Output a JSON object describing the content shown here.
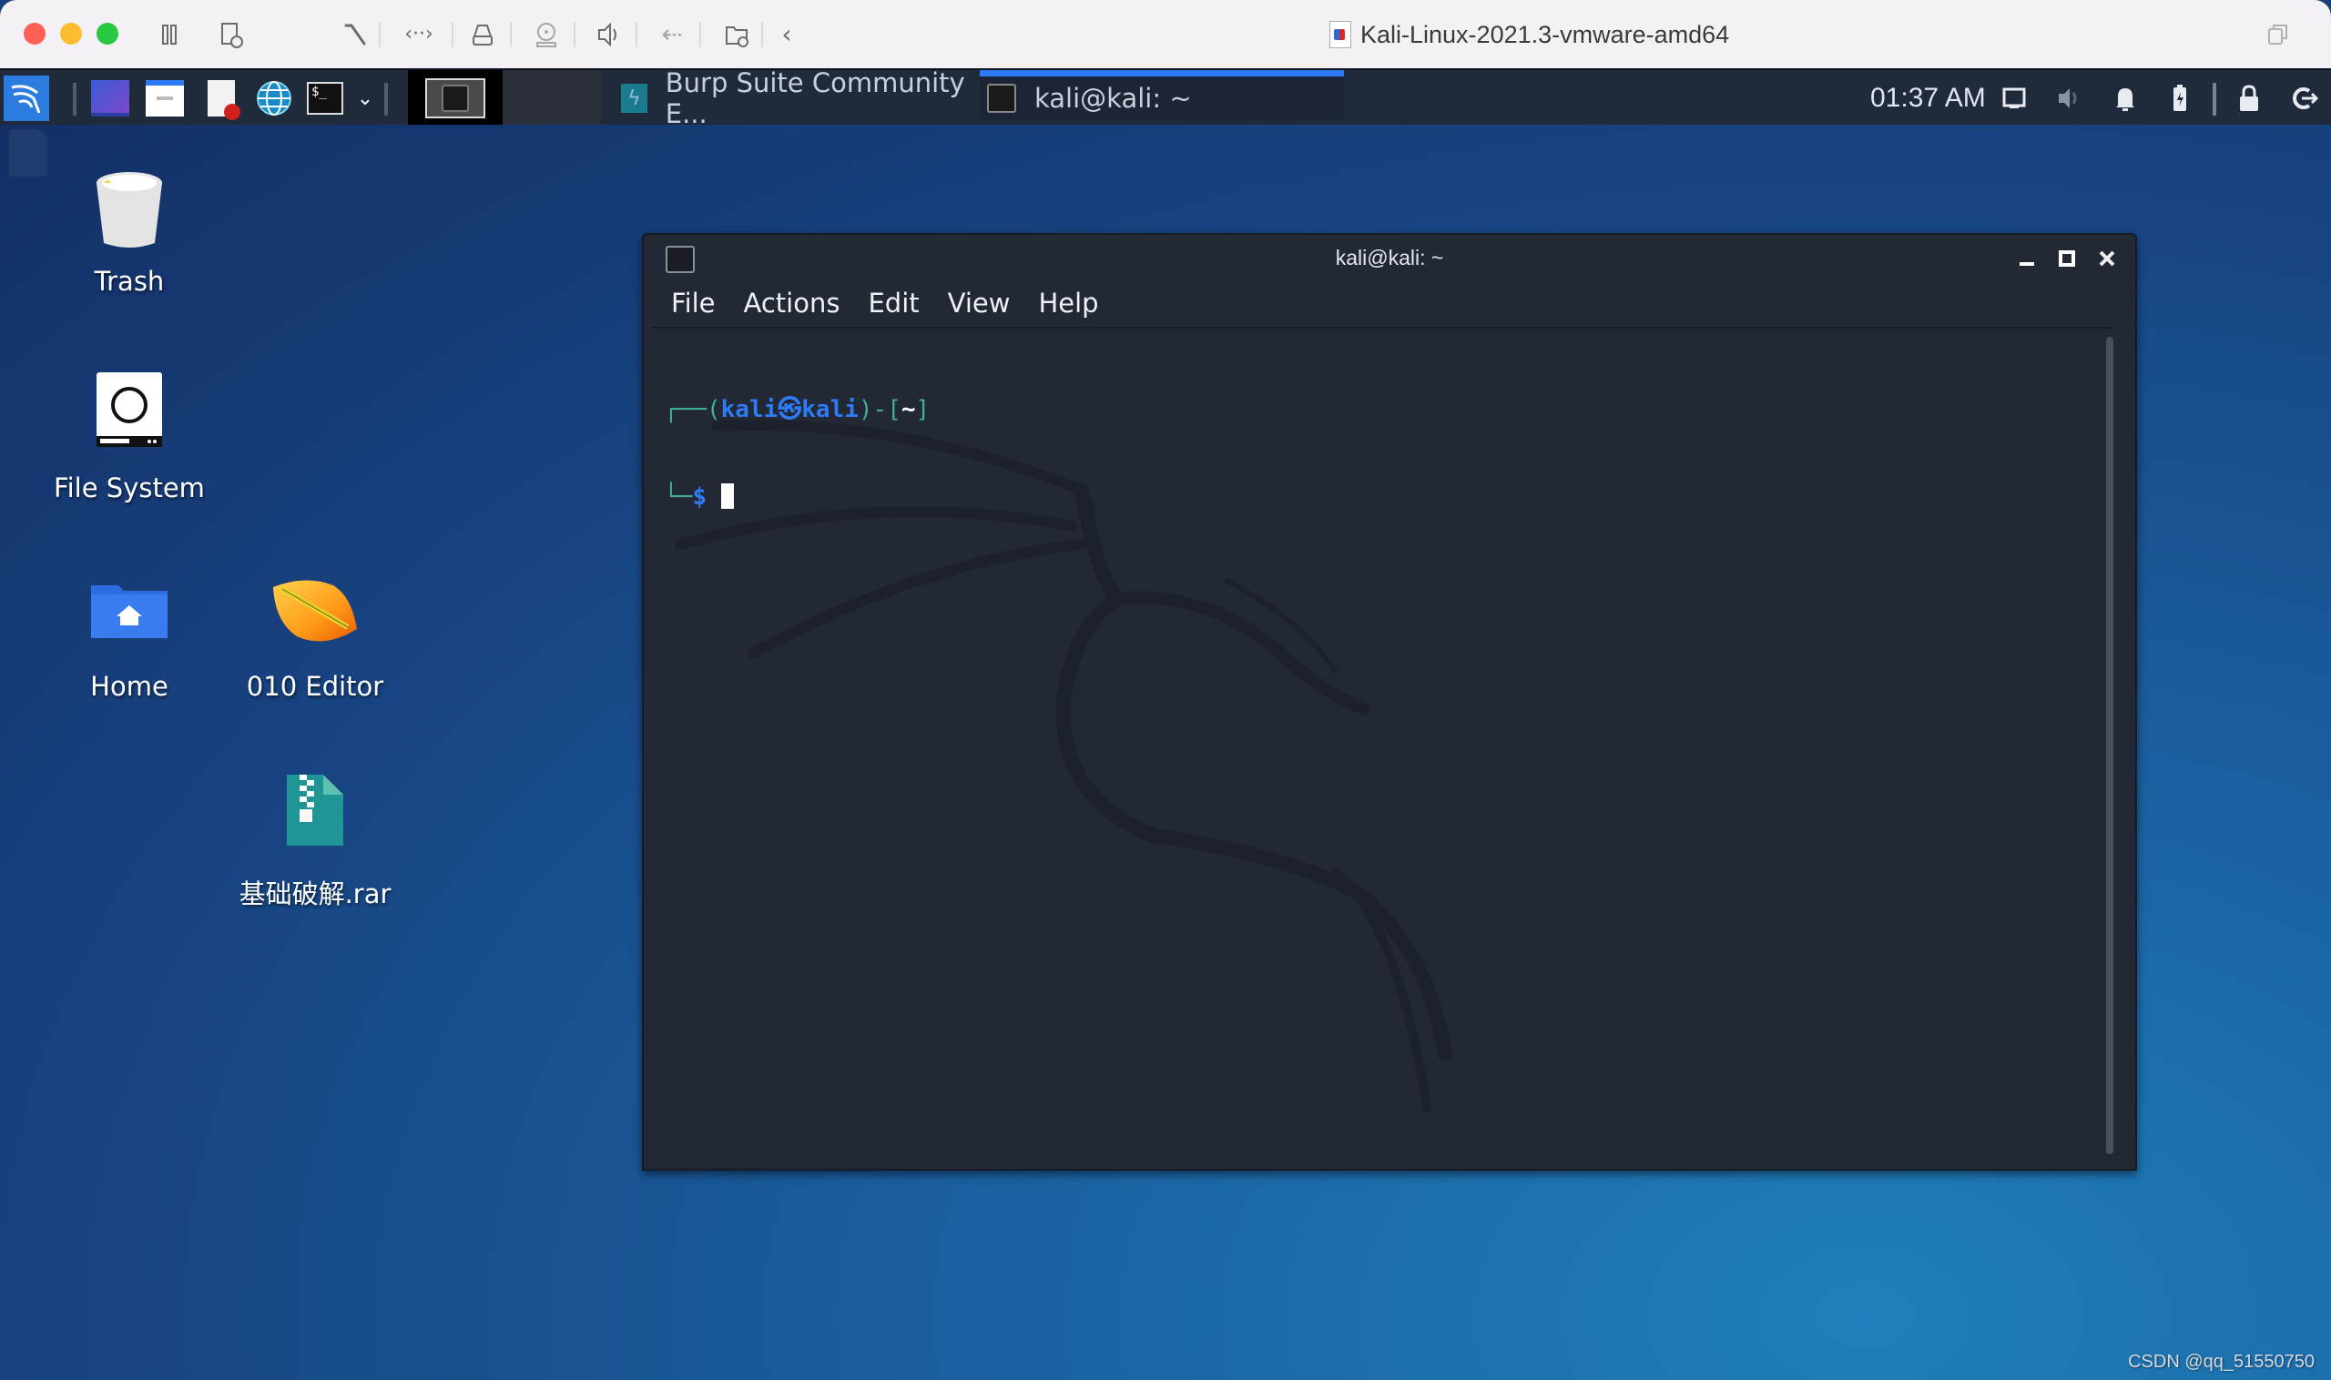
{
  "vm_window": {
    "title": "Kali-Linux-2021.3-vmware-amd64",
    "toolbar_icons": [
      "pause-icon",
      "snapshot-icon",
      "settings-wrench-icon",
      "network-icon",
      "disk-icon",
      "cd-dvd-icon",
      "sound-icon",
      "usb-icon",
      "shared-folder-icon",
      "back-chevron-icon"
    ]
  },
  "panel": {
    "launchers": [
      "kali-menu-icon",
      "show-desktop-icon",
      "file-manager-icon",
      "text-editor-icon",
      "web-browser-icon",
      "terminal-icon"
    ],
    "tasks": [
      {
        "label": "Burp Suite Community E...",
        "icon": "burp-suite-icon",
        "active": false
      },
      {
        "label": "kali@kali: ~",
        "icon": "terminal-icon",
        "active": true
      }
    ],
    "clock": "01:37 AM",
    "accent": "#2f7af5"
  },
  "desktop": {
    "icons": [
      {
        "label": "Trash",
        "icon": "trash-icon"
      },
      {
        "label": "File System",
        "icon": "drive-icon"
      },
      {
        "label": "Home",
        "icon": "home-folder-icon"
      },
      {
        "label": "010 Editor",
        "icon": "010-editor-icon"
      },
      {
        "label": "基础破解.rar",
        "icon": "archive-icon"
      }
    ],
    "watermark": "CSDN @qq_51550750"
  },
  "terminal": {
    "title": "kali@kali: ~",
    "menu": [
      "File",
      "Actions",
      "Edit",
      "View",
      "Help"
    ],
    "prompt": {
      "corner_top": "┌──(",
      "user": "kali",
      "at_symbol": "㉿",
      "host": "kali",
      "mid": ")-[",
      "cwd": "~",
      "end": "]",
      "corner_bottom": "└─",
      "dollar": "$"
    },
    "colors": {
      "frame": "#3fae9a",
      "user": "#2f7af5",
      "cursor": "#ffffff"
    }
  }
}
